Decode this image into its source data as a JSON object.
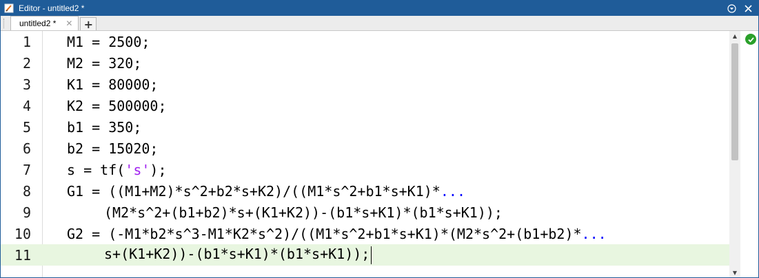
{
  "window": {
    "title": "Editor - untitled2 *"
  },
  "tabs": [
    {
      "label": "untitled2 *"
    }
  ],
  "tab_add_label": "+",
  "code_lines": [
    {
      "num": "1",
      "text": "M1 = 2500;"
    },
    {
      "num": "2",
      "text": "M2 = 320;"
    },
    {
      "num": "3",
      "text": "K1 = 80000;"
    },
    {
      "num": "4",
      "text": "K2 = 500000;"
    },
    {
      "num": "5",
      "text": "b1 = 350;"
    },
    {
      "num": "6",
      "text": "b2 = 15020;"
    },
    {
      "num": "7",
      "pre": "s = tf(",
      "str": "'s'",
      "post": ");"
    },
    {
      "num": "8",
      "text": "G1 = ((M1+M2)*s^2+b2*s+K2)/((M1*s^2+b1*s+K1)*",
      "ellipsis": "..."
    },
    {
      "num": "",
      "text": "(M2*s^2+(b1+b2)*s+(K1+K2))-(b1*s+K1)*(b1*s+K1));"
    },
    {
      "num": "10",
      "text": "G2 = (-M1*b2*s^3-M1*K2*s^2)/((M1*s^2+b1*s+K1)*(M2*s^2+(b1+b2)*",
      "ellipsis": "..."
    },
    {
      "num": "11",
      "text": "s+(K1+K2))-(b1*s+K1)*(b1*s+K1));"
    }
  ],
  "line9_num": "9",
  "colors": {
    "titlebar": "#1f5c99",
    "current_line": "#e8f6e0",
    "string": "#a020f0",
    "ellipsis": "#0000ff",
    "ok": "#2aa02a"
  },
  "icons": {
    "app": "matlab-editor-icon",
    "menu": "options-circle-icon",
    "close": "close-icon",
    "status": "code-ok-checkmark-icon"
  }
}
